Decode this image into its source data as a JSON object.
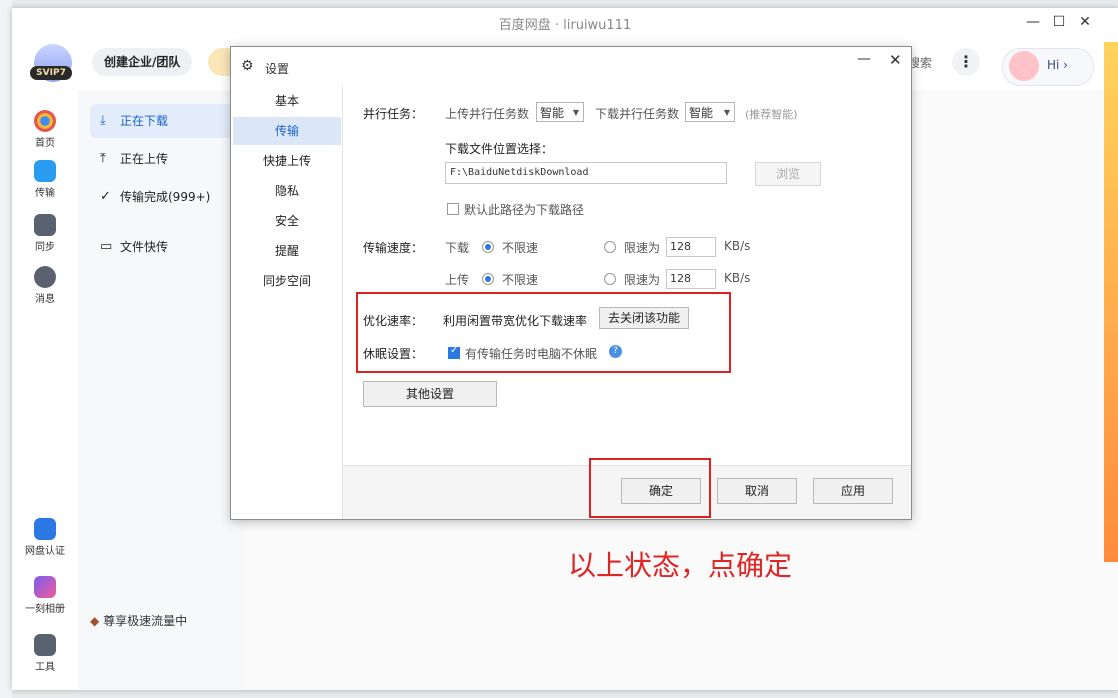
{
  "app_title": "百度网盘 · liruiwu111",
  "window_controls": {
    "minimize": "—",
    "maximize": "☐",
    "close": "✕"
  },
  "topbar": {
    "vip_badge": "SVIP7",
    "create_team": "创建企业/团队",
    "search_partial": "搜索",
    "more": "⋮",
    "hi": "Hi ›"
  },
  "left_nav": [
    {
      "label": "首页",
      "icon": "cloud-icon"
    },
    {
      "label": "传输",
      "icon": "transfer-icon"
    },
    {
      "label": "同步",
      "icon": "sync-icon"
    },
    {
      "label": "消息",
      "icon": "message-icon"
    }
  ],
  "left_nav_bottom": [
    {
      "label": "网盘认证",
      "icon": "verify-icon"
    },
    {
      "label": "一刻相册",
      "icon": "album-icon"
    },
    {
      "label": "工具",
      "icon": "tools-icon"
    }
  ],
  "subnav": {
    "items": [
      "正在下载",
      "正在上传",
      "传输完成(999+)",
      "文件快传"
    ],
    "promo": "尊享极速流量中"
  },
  "dialog": {
    "title": "设置",
    "tabs": [
      "基本",
      "传输",
      "快捷上传",
      "隐私",
      "安全",
      "提醒",
      "同步空间"
    ],
    "active_tab": "传输",
    "parallel": {
      "label": "并行任务：",
      "upload_label": "上传并行任务数",
      "upload_value": "智能",
      "download_label": "下载并行任务数",
      "download_value": "智能",
      "hint": "(推荐智能)"
    },
    "location": {
      "label": "下载文件位置选择：",
      "path": "F:\\BaiduNetdiskDownload",
      "browse": "浏览",
      "default_checkbox": "默认此路径为下载路径"
    },
    "speed": {
      "label": "传输速度：",
      "download": "下载",
      "upload": "上传",
      "unlimited": "不限速",
      "limit": "限速为",
      "download_limit_value": "128",
      "upload_limit_value": "128",
      "unit": "KB/s"
    },
    "optimize": {
      "label": "优化速率：",
      "text": "利用闲置带宽优化下载速率",
      "button": "去关闭该功能"
    },
    "sleep": {
      "label": "休眠设置：",
      "checkbox": "有传输任务时电脑不休眠",
      "help": "?"
    },
    "other_button": "其他设置",
    "footer": {
      "ok": "确定",
      "cancel": "取消",
      "apply": "应用"
    }
  },
  "annotation": "以上状态，点确定",
  "colors": {
    "accent": "#2b78e4",
    "annotation": "#e02525"
  }
}
